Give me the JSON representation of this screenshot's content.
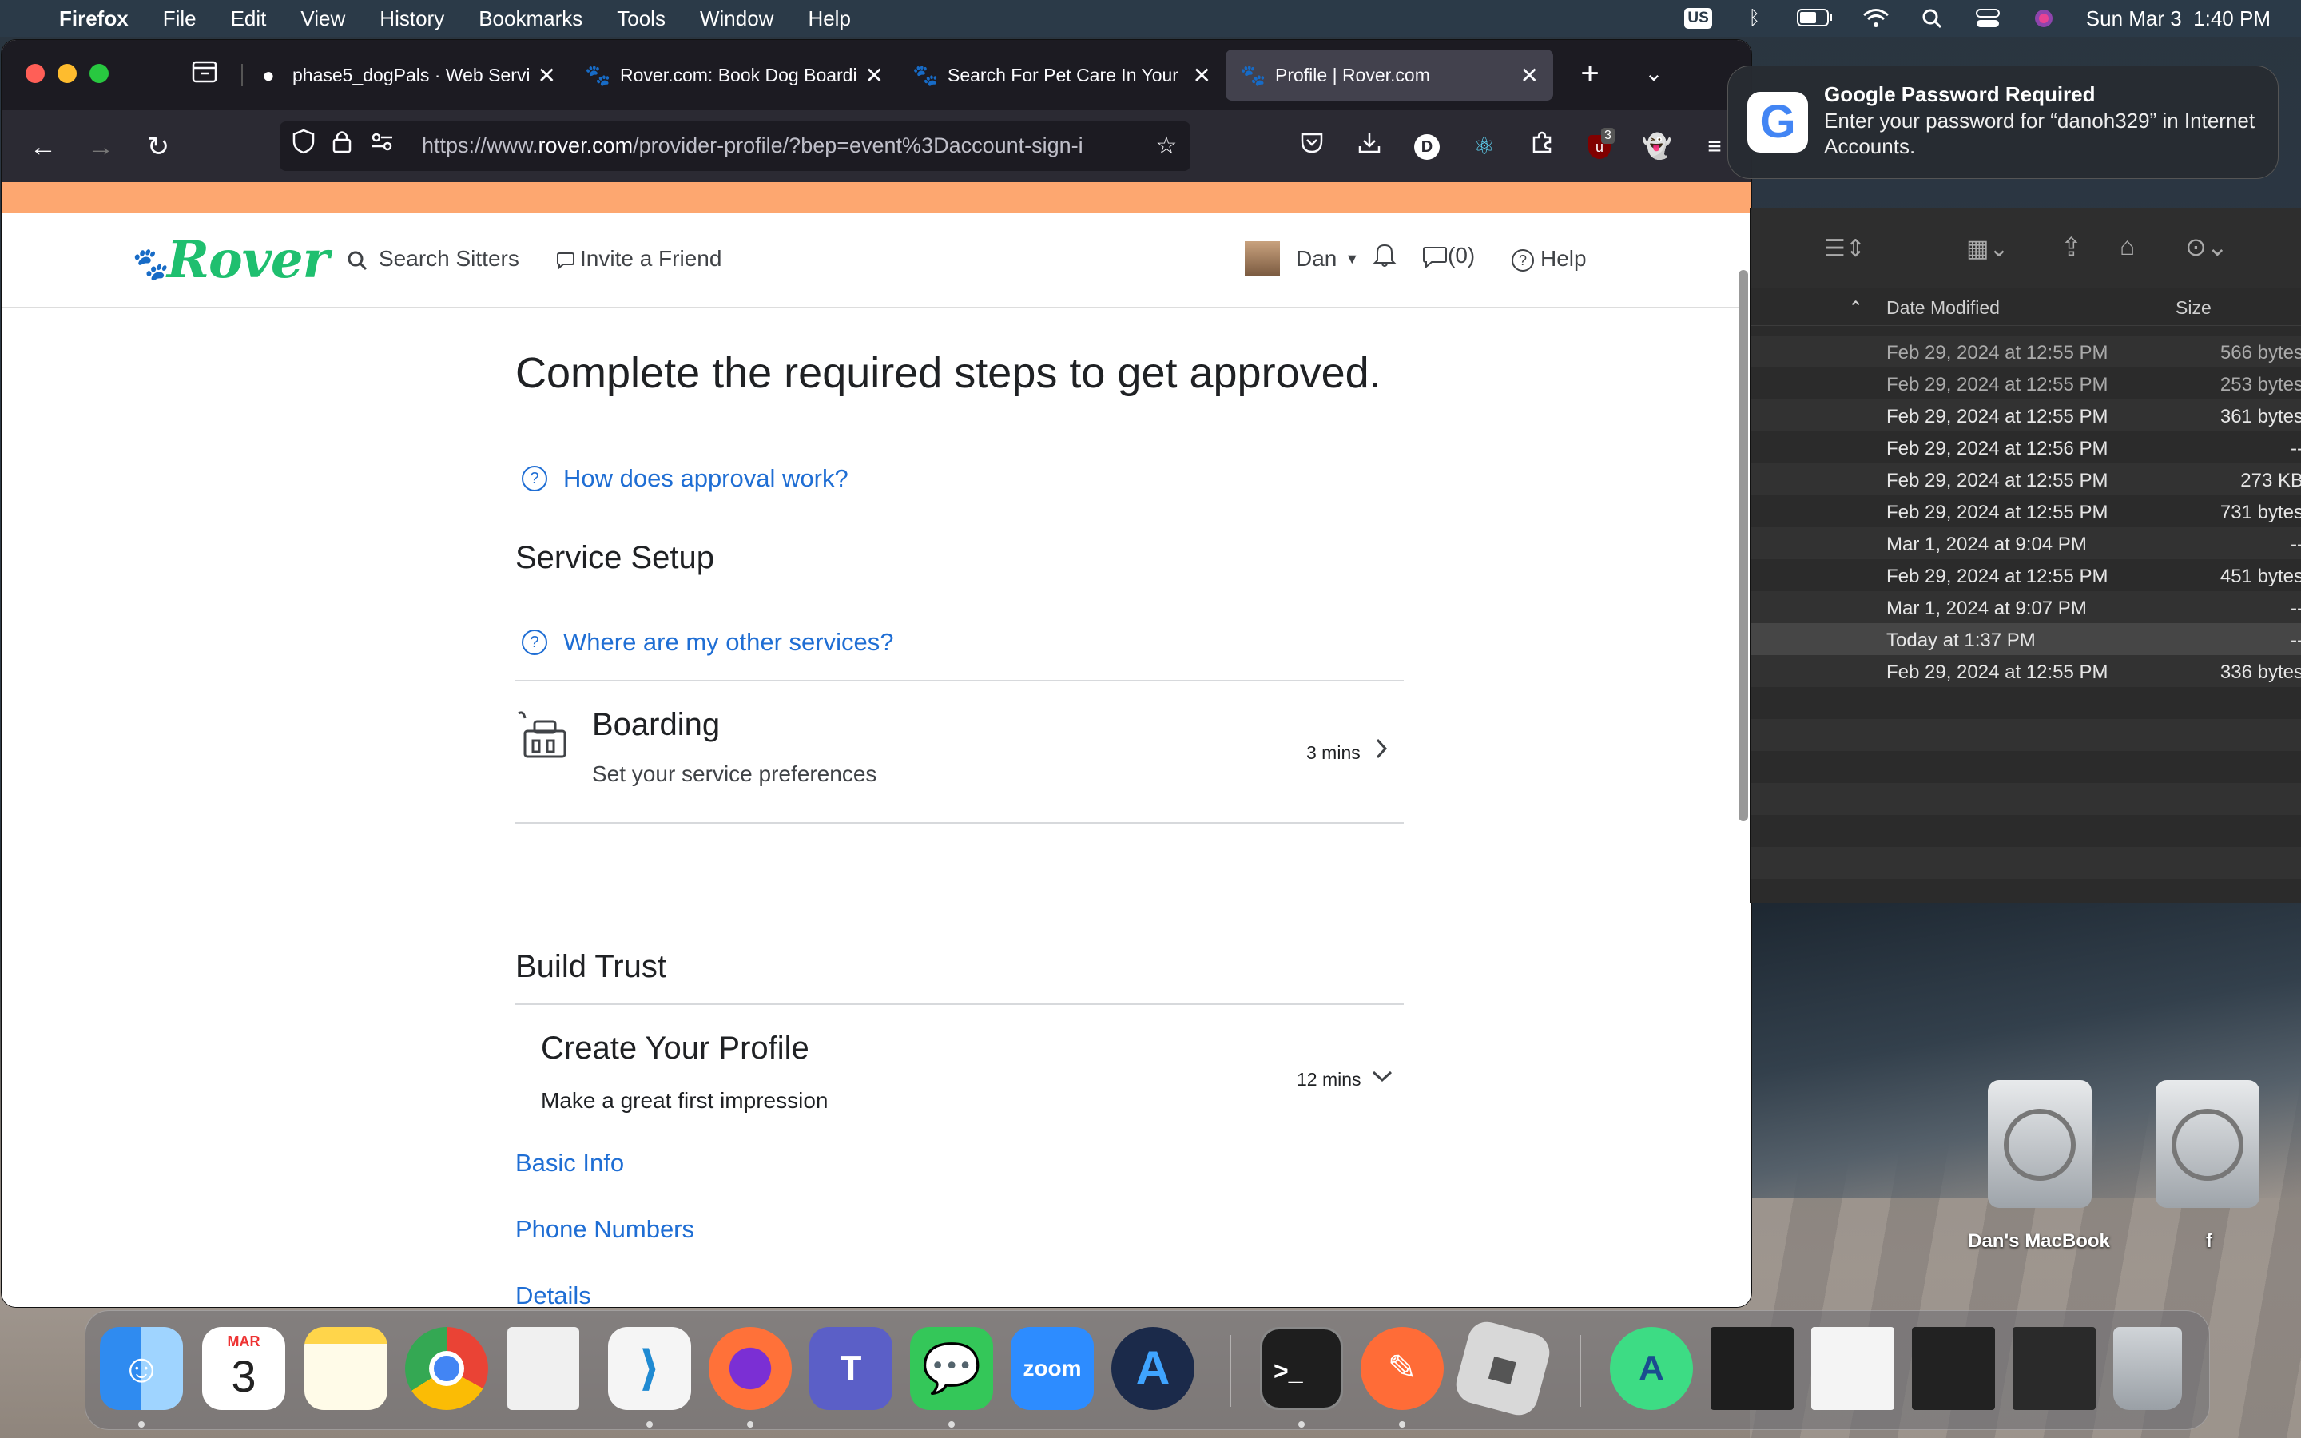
{
  "menubar": {
    "app": "Firefox",
    "items": [
      "File",
      "Edit",
      "View",
      "History",
      "Bookmarks",
      "Tools",
      "Window",
      "Help"
    ],
    "datetime": "Sun Mar 3  1:40 PM",
    "input_source": "US"
  },
  "browser": {
    "tabs": [
      {
        "title": "phase5_dogPals · Web Servi"
      },
      {
        "title": "Rover.com: Book Dog Boardi"
      },
      {
        "title": "Search For Pet Care In Your"
      },
      {
        "title": "Profile | Rover.com"
      }
    ],
    "url_prefix": "https://www.",
    "url_domain": "rover.com",
    "url_rest": "/provider-profile/?bep=event%3Daccount-sign-i",
    "ublock_count": "3"
  },
  "site": {
    "logo": "Rover",
    "nav": {
      "search": "Search Sitters",
      "invite": "Invite a Friend",
      "user": "Dan",
      "messages": "(0)",
      "help": "Help"
    },
    "heading": "Complete the required steps to get approved.",
    "approval_link": "How does approval work?",
    "service_setup": {
      "title": "Service Setup",
      "other_link": "Where are my other services?",
      "boarding": {
        "title": "Boarding",
        "subtitle": "Set your service preferences",
        "time": "3 mins"
      }
    },
    "build_trust": {
      "title": "Build Trust",
      "profile": {
        "title": "Create Your Profile",
        "subtitle": "Make a great first impression",
        "time": "12 mins"
      },
      "links": [
        "Basic Info",
        "Phone Numbers",
        "Details"
      ]
    }
  },
  "notification": {
    "title": "Google Password Required",
    "body": "Enter your password for “danoh329” in Internet Accounts.",
    "icon": "G"
  },
  "finder": {
    "columns": {
      "date": "Date Modified",
      "size": "Size"
    },
    "rows": [
      {
        "date": "Feb 29, 2024 at 12:55 PM",
        "size": "566 bytes"
      },
      {
        "date": "Feb 29, 2024 at 12:55 PM",
        "size": "253 bytes"
      },
      {
        "date": "Feb 29, 2024 at 12:55 PM",
        "size": "361 bytes"
      },
      {
        "date": "Feb 29, 2024 at 12:56 PM",
        "size": "--"
      },
      {
        "date": "Feb 29, 2024 at 12:55 PM",
        "size": "273 KB"
      },
      {
        "date": "Feb 29, 2024 at 12:55 PM",
        "size": "731 bytes"
      },
      {
        "date": "Mar 1, 2024 at 9:04 PM",
        "size": "--"
      },
      {
        "date": "Feb 29, 2024 at 12:55 PM",
        "size": "451 bytes"
      },
      {
        "date": "Mar 1, 2024 at 9:07 PM",
        "size": "--"
      },
      {
        "date": "Today at 1:37 PM",
        "size": "--"
      },
      {
        "date": "Feb 29, 2024 at 12:55 PM",
        "size": "336 bytes"
      }
    ]
  },
  "desktop": {
    "drives": [
      "Dan's MacBook",
      "f"
    ]
  },
  "dock": {
    "calendar_month": "MAR",
    "calendar_day": "3",
    "zoom_label": "zoom"
  }
}
